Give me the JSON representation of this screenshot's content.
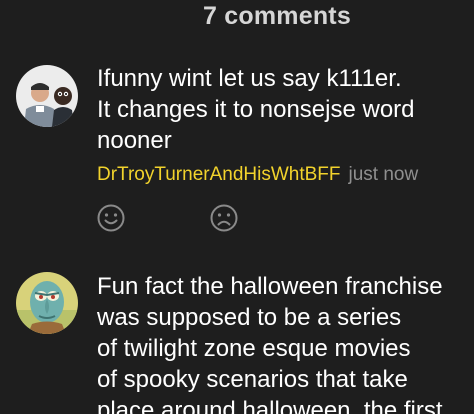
{
  "header": {
    "title": "7 comments"
  },
  "comments": [
    {
      "avatar_icon": "user-photo-avatar",
      "lines": [
        "Ifunny wint let us say k111er.",
        "It changes it to nonsejse word",
        "nooner"
      ],
      "username": "DrTroyTurnerAndHisWhtBFF",
      "timestamp": "just now",
      "smile_icon": "smile-face-icon",
      "frown_icon": "frown-face-icon"
    },
    {
      "avatar_icon": "cartoon-character-avatar",
      "lines": [
        "Fun fact the halloween franchise",
        "was supposed to be a series",
        "of twilight zone esque movies",
        "of spooky scenarios that take",
        "place around halloween, the first"
      ]
    }
  ],
  "colors": {
    "background": "#1e1e1e",
    "username": "#f2d32c",
    "timestamp": "#8f8f8f",
    "icon": "#8a8a8a",
    "header": "#d6d6d6"
  }
}
